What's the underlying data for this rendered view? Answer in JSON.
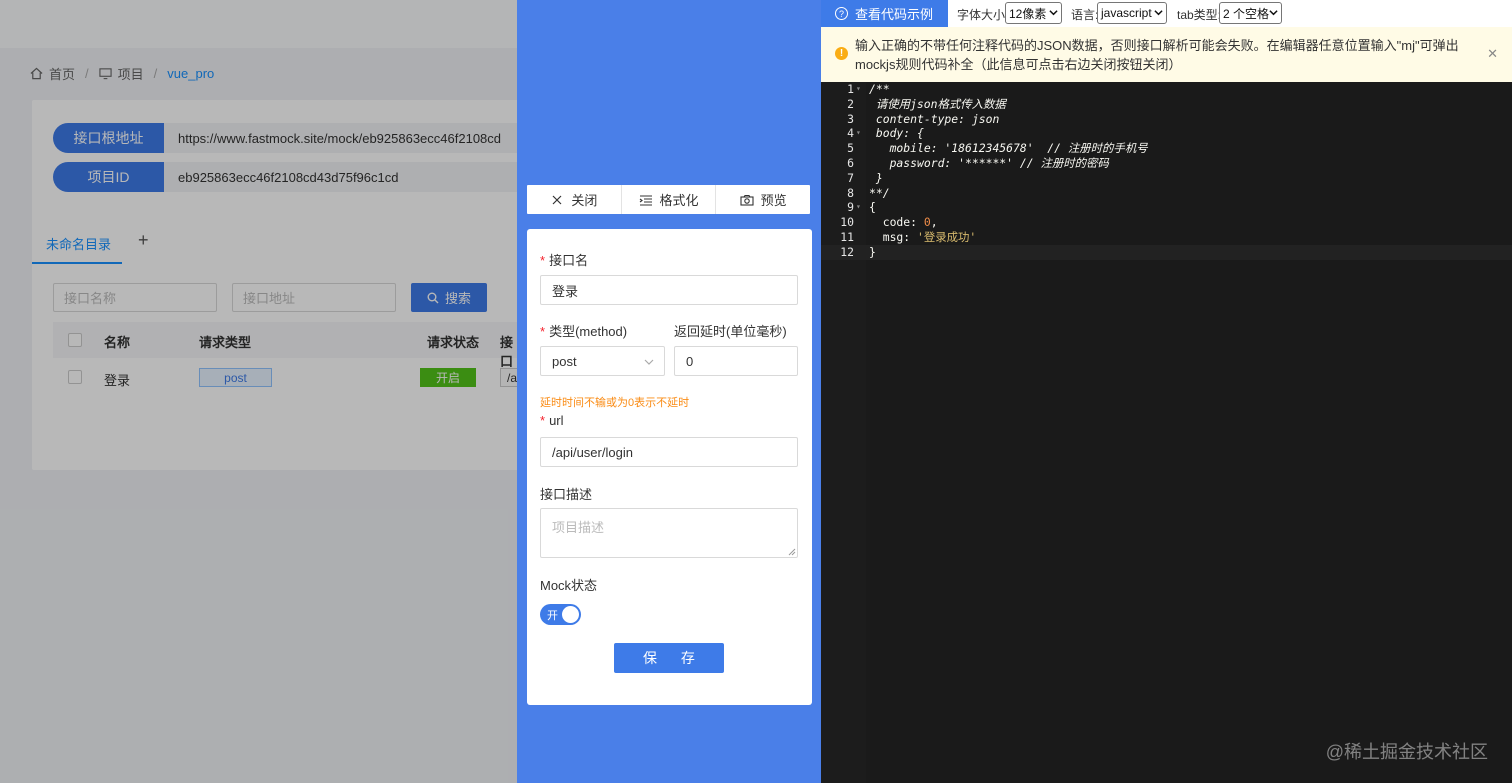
{
  "breadcrumb": {
    "home": "首页",
    "project": "项目",
    "current": "vue_pro"
  },
  "project_info": {
    "base_url_label": "接口根地址",
    "base_url_value": "https://www.fastmock.site/mock/eb925863ecc46f2108cd",
    "id_label": "项目ID",
    "id_value": "eb925863ecc46f2108cd43d75f96c1cd"
  },
  "directory_tab": "未命名目录",
  "add_tab_icon": "plus-icon",
  "search": {
    "name_placeholder": "接口名称",
    "url_placeholder": "接口地址",
    "button_label": "搜索"
  },
  "table": {
    "headers": [
      "名称",
      "请求类型",
      "请求状态",
      "接口"
    ],
    "rows": [
      {
        "name": "登录",
        "method": "post",
        "status": "开启",
        "url": "/a"
      }
    ]
  },
  "drawer": {
    "toolbar": {
      "close_label": "关闭",
      "format_label": "格式化",
      "preview_label": "预览"
    },
    "form": {
      "name_label": "接口名",
      "name_value": "登录",
      "method_label": "类型(method)",
      "method_value": "post",
      "delay_label": "返回延时(单位毫秒)",
      "delay_value": "0",
      "delay_hint": "延时时间不输或为0表示不延时",
      "url_label": "url",
      "url_value": "/api/user/login",
      "desc_label": "接口描述",
      "desc_placeholder": "项目描述",
      "mock_label": "Mock状态",
      "mock_toggle_text": "开",
      "mock_enabled": true,
      "save_label": "保 存"
    }
  },
  "editor": {
    "example_tab": "查看代码示例",
    "font_size_label": "字体大小:",
    "font_size_value": "12像素",
    "language_label": "语言:",
    "language_value": "javascript",
    "tab_type_label": "tab类型:",
    "tab_type_value": "2 个空格",
    "warning_text": "输入正确的不带任何注释代码的JSON数据，否则接口解析可能会失败。在编辑器任意位置输入\"mj\"可弹出mockjs规则代码补全（此信息可点击右边关闭按钮关闭）",
    "lines": [
      {
        "n": "1",
        "fold": "▾",
        "text": "/**",
        "cls": "cm"
      },
      {
        "n": "2",
        "fold": "",
        "text": " 请使用json格式传入数据",
        "cls": "cm"
      },
      {
        "n": "3",
        "fold": "",
        "text": " content-type: json",
        "cls": "cm"
      },
      {
        "n": "4",
        "fold": "▾",
        "text": " body: {",
        "cls": "cm"
      },
      {
        "n": "5",
        "fold": "",
        "text": "   mobile: '18612345678'  // 注册时的手机号",
        "cls": "cm"
      },
      {
        "n": "6",
        "fold": "",
        "text": "   password: '******' // 注册时的密码",
        "cls": "cm"
      },
      {
        "n": "7",
        "fold": "",
        "text": " }",
        "cls": "cm"
      },
      {
        "n": "8",
        "fold": "",
        "text": "**/",
        "cls": "cm"
      },
      {
        "n": "9",
        "fold": "▾",
        "text": "{",
        "cls": ""
      },
      {
        "n": "10",
        "fold": "",
        "text": "  code: 0,",
        "cls": ""
      },
      {
        "n": "11",
        "fold": "",
        "text": "  msg: '登录成功'",
        "cls": ""
      },
      {
        "n": "12",
        "fold": "",
        "text": "}",
        "cls": ""
      }
    ]
  },
  "watermark": "@稀土掘金技术社区",
  "colors": {
    "primary": "#3e7be8",
    "drawer_bg": "#4a7fe8",
    "editor_bg": "#1a1a1a",
    "warning_bg": "#fffbe6",
    "status_on": "#52c41a",
    "required": "#f5222d",
    "hint": "#fa8c16"
  }
}
